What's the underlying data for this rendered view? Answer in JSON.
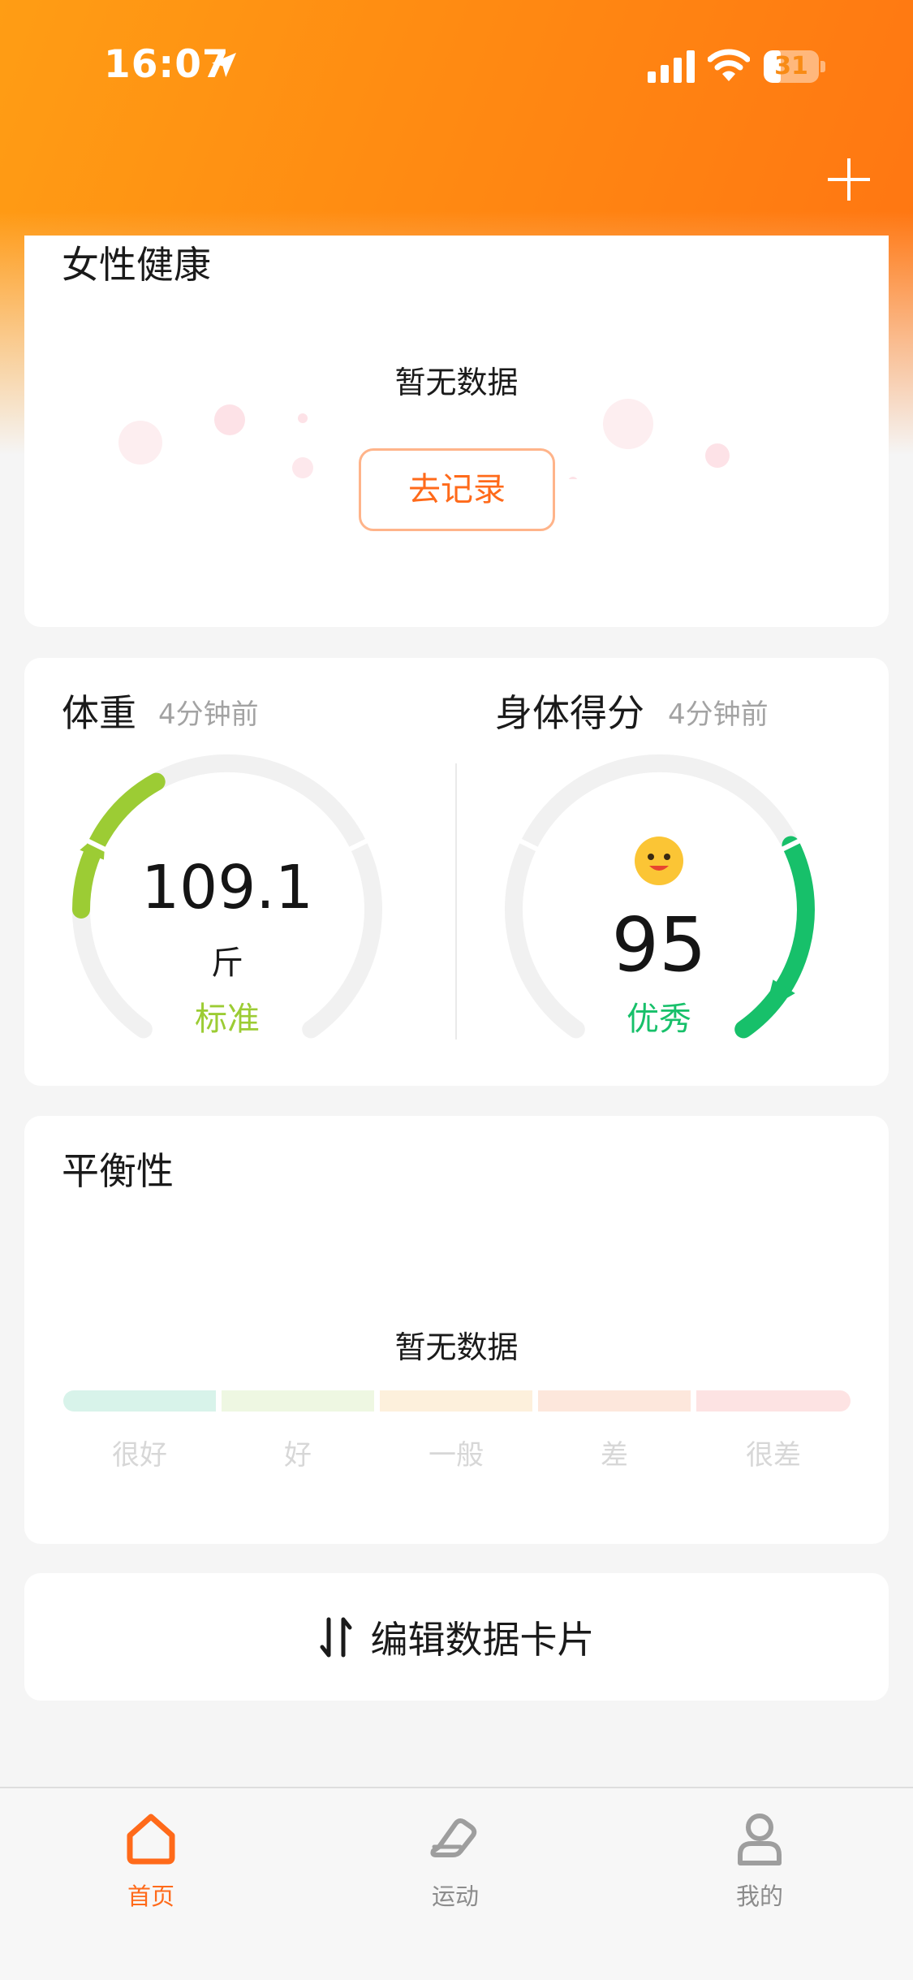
{
  "status_bar": {
    "time": "16:07",
    "battery": "31",
    "battery_level": 0.31
  },
  "colors": {
    "accent": "#ff6a1a",
    "weight_green": "#9ccc34",
    "score_green": "#17c06a"
  },
  "female_health": {
    "title": "女性健康",
    "empty_text": "暂无数据",
    "record_button": "去记录"
  },
  "weight": {
    "title": "体重",
    "time_ago": "4分钟前",
    "value": "109.1",
    "unit": "斤",
    "status": "标准",
    "gauge_level": 0.4
  },
  "body_score": {
    "title": "身体得分",
    "time_ago": "4分钟前",
    "emoji": "smiley-face-icon",
    "value": "95",
    "status": "优秀",
    "gauge_level": 0.95
  },
  "balance": {
    "title": "平衡性",
    "empty_text": "暂无数据",
    "levels": [
      {
        "label": "很好",
        "color": "#d8f3ea"
      },
      {
        "label": "好",
        "color": "#eef7e2"
      },
      {
        "label": "一般",
        "color": "#fdf0dc"
      },
      {
        "label": "差",
        "color": "#fde7dc"
      },
      {
        "label": "很差",
        "color": "#fde3e3"
      }
    ]
  },
  "edit_cards": {
    "label": "编辑数据卡片",
    "icon": "sort-arrows-icon"
  },
  "tabbar": {
    "items": [
      {
        "label": "首页",
        "icon": "home-icon",
        "active": true
      },
      {
        "label": "运动",
        "icon": "shoe-icon",
        "active": false
      },
      {
        "label": "我的",
        "icon": "user-icon",
        "active": false
      }
    ]
  }
}
